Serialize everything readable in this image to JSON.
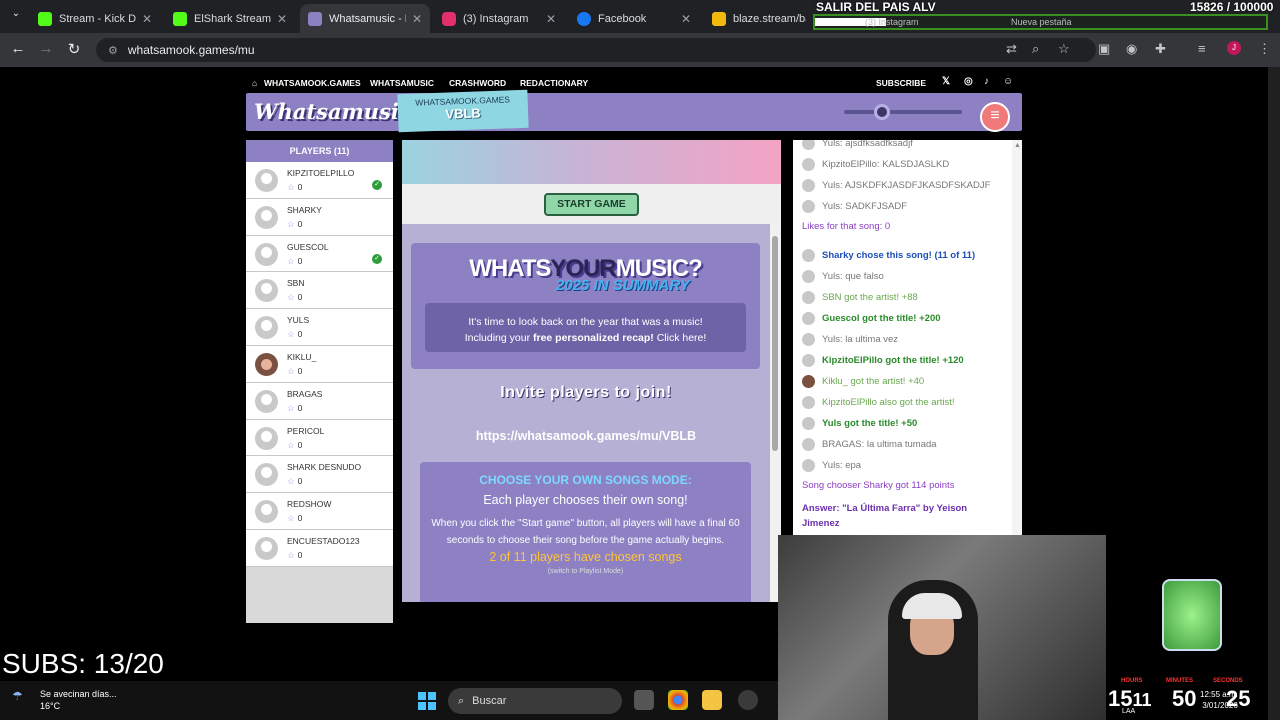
{
  "browser": {
    "tabs": [
      {
        "title": "Stream - Kick Dashb",
        "color": "#53fc18"
      },
      {
        "title": "ElShark Stream - W",
        "color": "#53fc18"
      },
      {
        "title": "Whatsamusic - N",
        "color": "#8d81c4"
      },
      {
        "title": "(3) Instagram",
        "color": "#e1306c"
      },
      {
        "title": "Facebook",
        "color": "#1877f2"
      },
      {
        "title": "blaze.stream/back",
        "color": "#f0b90b"
      }
    ],
    "close": "✕",
    "url": "whatsamook.games/mu"
  },
  "overlay": {
    "title": "SALIR DEL PAIS ALV",
    "progress": "15826 / 100000",
    "progress_fraction": 0.158,
    "ghost_tab1": "(3) Instagram",
    "ghost_tab2": "Nueva pestaña"
  },
  "site": {
    "nav": {
      "home": "WHATSAMOOK.GAMES",
      "music": "WHATSAMUSIC",
      "crash": "CRASHWORD",
      "redact": "REDACTIONARY",
      "subscribe": "SUBSCRIBE"
    },
    "logo": "Whatsamusic",
    "room_label": "WHATSAMOOK.GAMES",
    "room_code": "VBLB",
    "volume_fraction": 0.32
  },
  "players": {
    "header": "PLAYERS (11)",
    "list": [
      {
        "name": "KIPZITOELPILLO",
        "score": "0",
        "chosen": true
      },
      {
        "name": "SHARKY",
        "score": "0",
        "chosen": false
      },
      {
        "name": "GUESCOL",
        "score": "0",
        "chosen": true
      },
      {
        "name": "SBN",
        "score": "0",
        "chosen": false
      },
      {
        "name": "YULS",
        "score": "0",
        "chosen": false
      },
      {
        "name": "KIKLU_",
        "score": "0",
        "chosen": false
      },
      {
        "name": "BRAGAS",
        "score": "0",
        "chosen": false
      },
      {
        "name": "PERICOL",
        "score": "0",
        "chosen": false
      },
      {
        "name": "SHARK DESNUDO",
        "score": "0",
        "chosen": false
      },
      {
        "name": "REDSHOW",
        "score": "0",
        "chosen": false
      },
      {
        "name": "ENCUESTADO123",
        "score": "0",
        "chosen": false
      }
    ]
  },
  "game": {
    "start_button": "START GAME",
    "promo": {
      "whats": "WHATS",
      "your": "YOUR",
      "music": "MUSIC?",
      "summary": "2025 IN SUMMARY",
      "line1": "It's time to look back on the year that was a music!",
      "line2a": "Including your ",
      "line2b": "free personalized recap!",
      "line2c": " Click here!"
    },
    "invite": "Invite players to join!",
    "invite_url": "https://whatsamook.games/mu/VBLB",
    "mode": {
      "heading": "CHOOSE YOUR OWN SONGS MODE:",
      "sub": "Each player chooses their own song!",
      "desc": "When you click the \"Start game\" button, all players will have a final 60 seconds to choose their song before the game actually begins.",
      "chosen": "2 of 11 players have chosen songs",
      "switch": "(switch to Playlist Mode)"
    }
  },
  "chat": [
    {
      "text": "Yuls: ajsdfksadfksadjf",
      "style": "grey",
      "avatar": "plain"
    },
    {
      "text": "KipzitoElPillo: KALSDJASLKD",
      "style": "grey",
      "avatar": "plain"
    },
    {
      "text": "Yuls: AJSKDFKJASDFJKASDFSKADJF",
      "style": "grey",
      "avatar": "plain"
    },
    {
      "text": "Yuls: SADKFJSADF",
      "style": "grey",
      "avatar": "plain"
    },
    {
      "text": "Likes for that song: 0",
      "style": "purple",
      "avatar": "none"
    },
    {
      "text": "Sharky chose this song! (11 of 11)",
      "style": "blue",
      "avatar": "plain"
    },
    {
      "text": "Yuls: que falso",
      "style": "grey",
      "avatar": "plain"
    },
    {
      "text": "SBN got the artist! +88",
      "style": "lgreen",
      "avatar": "plain"
    },
    {
      "text": "Guescol got the title! +200",
      "style": "green",
      "avatar": "plain"
    },
    {
      "text": "Yuls: la ultima vez",
      "style": "grey",
      "avatar": "plain"
    },
    {
      "text": "KipzitoElPillo got the title! +120",
      "style": "green",
      "avatar": "plain"
    },
    {
      "text": "Kiklu_ got the artist! +40",
      "style": "lgreen",
      "avatar": "photo"
    },
    {
      "text": "KipzitoElPillo also got the artist!",
      "style": "lgreen",
      "avatar": "plain"
    },
    {
      "text": "Yuls got the title! +50",
      "style": "green",
      "avatar": "plain"
    },
    {
      "text": "BRAGAS: la ultima tumada",
      "style": "grey",
      "avatar": "plain"
    },
    {
      "text": "Yuls: epa",
      "style": "grey",
      "avatar": "plain"
    },
    {
      "text": "Song chooser Sharky got 114 points",
      "style": "purple",
      "avatar": "none"
    },
    {
      "text": "Answer: \"La Última Farra\" by Yeison Jimenez",
      "style": "purpleb",
      "avatar": "none"
    }
  ],
  "stream": {
    "subs": "SUBS: 13/20",
    "timer_hours": "15",
    "timer_hours_frac": "11",
    "timer_minutes": "50",
    "timer_seconds": "25",
    "timer_label_hours": "HOURS",
    "timer_label_minutes": "MINUTES",
    "timer_label_seconds": "SECONDS"
  },
  "taskbar": {
    "weather_title": "Se avecinan días...",
    "weather_temp": "16°C",
    "search": "Buscar",
    "clock_time": "12:55 a.m.",
    "clock_date": "3/01/2026",
    "lang": "LAA"
  }
}
